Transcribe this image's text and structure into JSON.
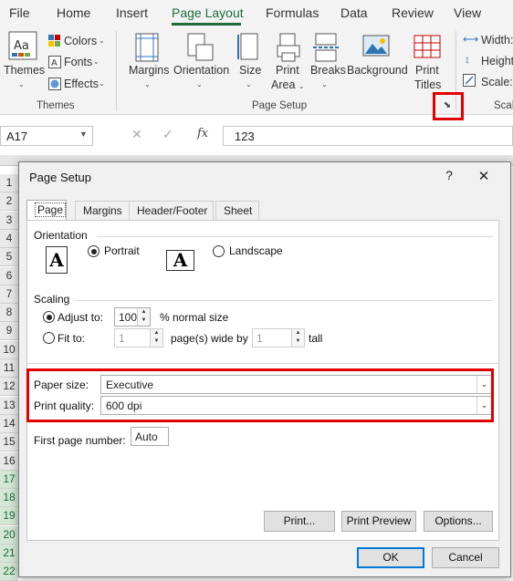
{
  "ribbon": {
    "tabs": [
      "File",
      "Home",
      "Insert",
      "Page Layout",
      "Formulas",
      "Data",
      "Review",
      "View"
    ],
    "themes_group": {
      "themes_label": "Themes",
      "colors_label": "Colors",
      "fonts_label": "Fonts",
      "effects_label": "Effects",
      "group_label": "Themes"
    },
    "page_setup_group": {
      "margins_label": "Margins",
      "orientation_label": "Orientation",
      "size_label": "Size",
      "print_area_label_1": "Print",
      "print_area_label_2": "Area",
      "breaks_label": "Breaks",
      "background_label": "Background",
      "print_titles_label_1": "Print",
      "print_titles_label_2": "Titles",
      "group_label": "Page Setup"
    },
    "scale_group": {
      "width_label": "Width:",
      "height_label": "Height",
      "scale_label": "Scale:",
      "group_label": "Scal"
    }
  },
  "formula_bar": {
    "name_box": "A17",
    "formula_value": "123",
    "fx_label": "fx"
  },
  "grid": {
    "row_numbers": [
      "1",
      "2",
      "3",
      "4",
      "5",
      "6",
      "7",
      "8",
      "9",
      "10",
      "11",
      "12",
      "13",
      "14",
      "15",
      "16",
      "17",
      "18",
      "19",
      "20",
      "21",
      "22"
    ]
  },
  "dialog": {
    "title": "Page Setup",
    "help": "?",
    "close": "✕",
    "tabs": [
      "Page",
      "Margins",
      "Header/Footer",
      "Sheet"
    ],
    "orientation": {
      "section_label": "Orientation",
      "portrait_label": "Portrait",
      "landscape_label": "Landscape",
      "icon_letter": "A",
      "selected": "portrait"
    },
    "scaling": {
      "section_label": "Scaling",
      "adjust_to_label": "Adjust to:",
      "adjust_to_value": "100",
      "normal_size_label": "% normal size",
      "fit_to_label": "Fit to:",
      "pages_wide_value": "1",
      "pages_wide_label": "page(s) wide by",
      "pages_tall_value": "1",
      "tall_label": "tall",
      "selected": "adjust_to"
    },
    "paper_size_label": "Paper size:",
    "paper_size_value": "Executive",
    "print_quality_label": "Print quality:",
    "print_quality_value": "600 dpi",
    "first_page_number_label": "First page number:",
    "first_page_number_value": "Auto",
    "buttons": {
      "print": "Print...",
      "print_preview": "Print Preview",
      "options": "Options...",
      "ok": "OK",
      "cancel": "Cancel"
    }
  },
  "highlight_color": "#e00000",
  "accent_color": "#1e6c3a"
}
